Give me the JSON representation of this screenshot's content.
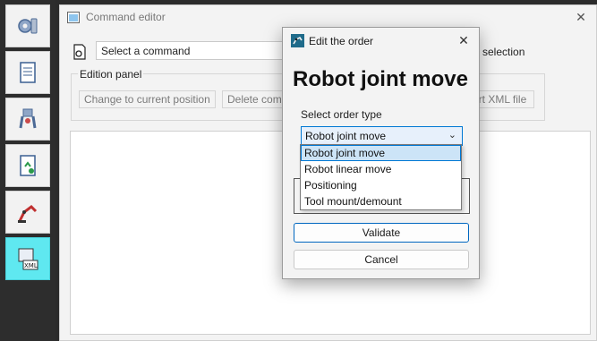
{
  "sidebar": {
    "items": [
      {
        "icon": "settings-gear-icon"
      },
      {
        "icon": "document-list-icon"
      },
      {
        "icon": "robot-gripper-icon"
      },
      {
        "icon": "upload-document-icon"
      },
      {
        "icon": "robot-arm-icon"
      },
      {
        "icon": "xml-file-icon",
        "active": true
      }
    ]
  },
  "main_window": {
    "title": "Command editor",
    "command_select_value": "Select a command",
    "selection_label": "selection",
    "edition_panel_title": "Edition panel",
    "edition_buttons": [
      "Change to current position",
      "Delete com",
      "ort XML file"
    ]
  },
  "dialog": {
    "title": "Edit the order",
    "heading": "Robot joint move",
    "select_label": "Select order type",
    "selected_value": "Robot joint move",
    "options": [
      "Robot joint move",
      "Robot linear move",
      "Positioning",
      "Tool mount/demount"
    ],
    "validate_label": "Validate",
    "cancel_label": "Cancel"
  },
  "colors": {
    "accent": "#0078d4",
    "active_sidebar": "#5fe8f0",
    "selected_option": "#cce4f7"
  }
}
